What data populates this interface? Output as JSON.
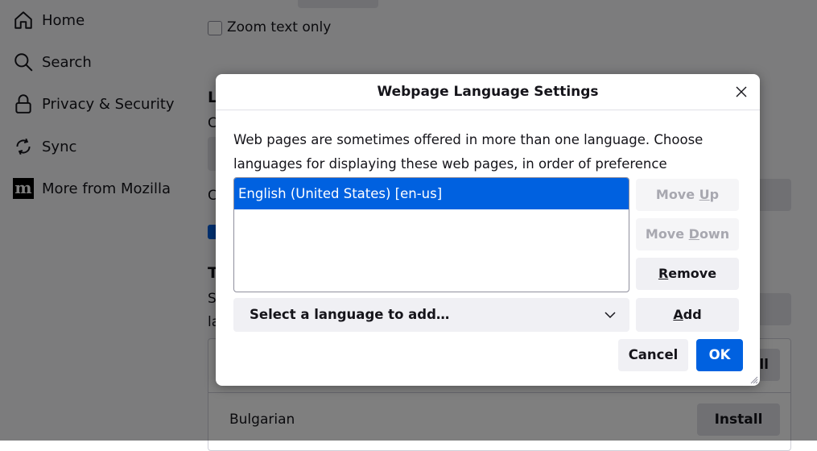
{
  "sidebar": {
    "items": [
      {
        "label": "Home",
        "icon": "home-icon"
      },
      {
        "label": "Search",
        "icon": "search-icon"
      },
      {
        "label": "Privacy & Security",
        "icon": "lock-icon"
      },
      {
        "label": "Sync",
        "icon": "sync-icon"
      },
      {
        "label": "More from Mozilla",
        "icon": "mozilla-icon"
      }
    ]
  },
  "background": {
    "zoom_text_only_label": "Zoom text only",
    "zoom_text_only_checked": false,
    "section_heading_l": "L",
    "text_c1": "C",
    "text_c2": "C",
    "section_heading_t": "T",
    "text_s": "S",
    "text_la": "la",
    "list_rows": [
      {
        "name": "",
        "action": "Install"
      },
      {
        "name": "Bulgarian",
        "action": "Install"
      }
    ],
    "partial_install_label": "ll"
  },
  "dialog": {
    "title": "Webpage Language Settings",
    "description": "Web pages are sometimes offered in more than one language. Choose languages for displaying these web pages, in order of preference",
    "languages": [
      {
        "label": "English (United States) [en-us]",
        "selected": true
      }
    ],
    "buttons": {
      "move_up": {
        "pre": "Move ",
        "key": "U",
        "post": "p",
        "disabled": true
      },
      "move_down": {
        "pre": "Move ",
        "key": "D",
        "post": "own",
        "disabled": true
      },
      "remove": {
        "pre": "",
        "key": "R",
        "post": "emove",
        "disabled": false
      },
      "add": {
        "pre": "",
        "key": "A",
        "post": "dd",
        "disabled": false
      }
    },
    "select_placeholder": "Select a language to add…",
    "cancel_label": "Cancel",
    "ok_label": "OK"
  },
  "colors": {
    "accent": "#0061e0",
    "overlay": "rgba(0,0,0,0.5)"
  }
}
